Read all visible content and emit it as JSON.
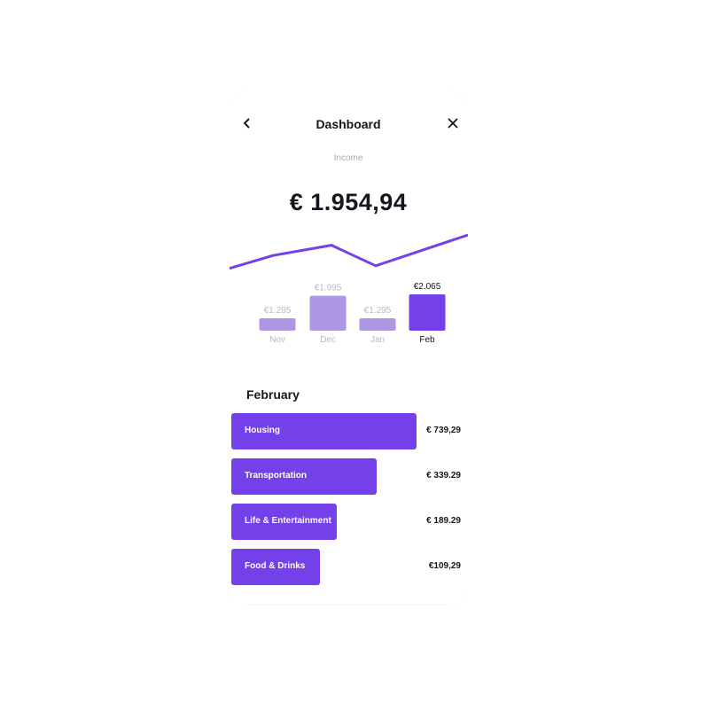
{
  "header": {
    "title": "Dashboard",
    "back_icon": "chevron-left-icon",
    "close_icon": "close-icon"
  },
  "income": {
    "label": "Income",
    "amount": "€ 1.954,94"
  },
  "colors": {
    "accent": "#7340ea",
    "bar_inactive": "#af98e3",
    "line": "#7340ea"
  },
  "chart_data": {
    "type": "bar",
    "title": "",
    "categories": [
      "Nov",
      "Dec",
      "Jan",
      "Feb"
    ],
    "values": [
      1295,
      1995,
      1295,
      2065
    ],
    "value_labels": [
      "€1.295",
      "€1.995",
      "€1.295",
      "€2.065"
    ],
    "highlighted": "Feb",
    "trend_line": {
      "type": "line",
      "relative_values": [
        0.35,
        0.6,
        0.8,
        0.4,
        1.0
      ]
    },
    "xlabel": "",
    "ylabel": ""
  },
  "breakdown": {
    "title": "February",
    "max_value": 739.29,
    "items": [
      {
        "label": "Housing",
        "value": 739.29,
        "display": "€ 739,29"
      },
      {
        "label": "Transportation",
        "value": 339.29,
        "display": "€ 339.29"
      },
      {
        "label": "Life & Entertainment",
        "value": 189.29,
        "display": "€ 189.29"
      },
      {
        "label": "Food & Drinks",
        "value": 109.29,
        "display": "€109,29"
      }
    ]
  }
}
